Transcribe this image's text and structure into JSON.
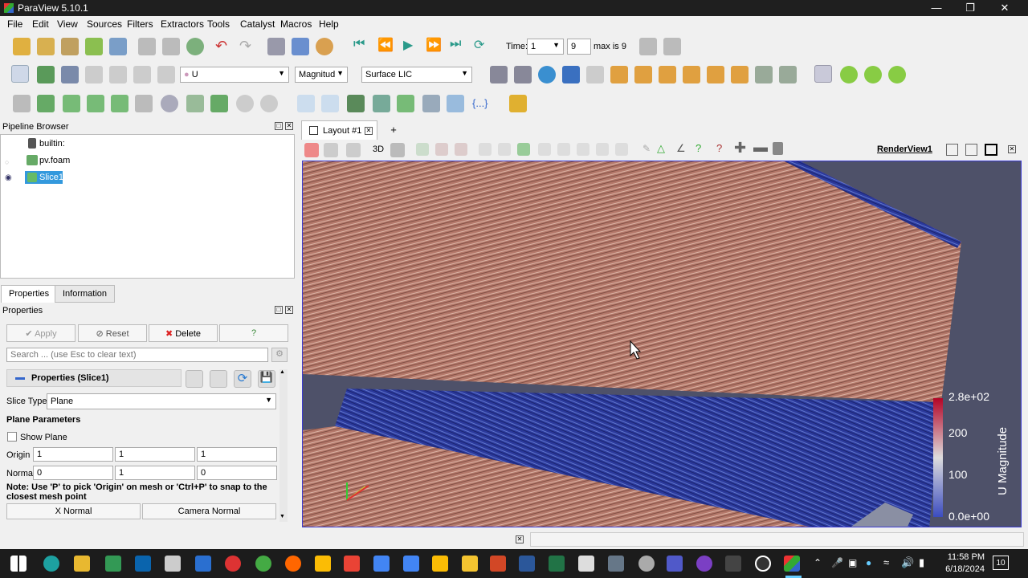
{
  "window": {
    "title": "ParaView 5.10.1"
  },
  "menu": [
    "File",
    "Edit",
    "View",
    "Sources",
    "Filters",
    "Extractors",
    "Tools",
    "Catalyst",
    "Macros",
    "Help"
  ],
  "time_toolbar": {
    "time_label": "Time:",
    "time_value": "1",
    "step_value": "9",
    "max_label": "max is 9"
  },
  "display_toolbar": {
    "array": "U",
    "component": "Magnitud",
    "representation": "Surface LIC"
  },
  "pipeline_browser": {
    "title": "Pipeline Browser",
    "items": [
      {
        "label": "builtin:"
      },
      {
        "label": "pv.foam"
      },
      {
        "label": "Slice1"
      }
    ]
  },
  "properties": {
    "tabs": [
      "Properties",
      "Information"
    ],
    "title": "Properties",
    "apply": "Apply",
    "reset": "Reset",
    "delete": "Delete",
    "help": "?",
    "search_placeholder": "Search ... (use Esc to clear text)",
    "section": "Properties (Slice1)",
    "slice_type_label": "Slice Type",
    "slice_type_value": "Plane",
    "plane_params": "Plane Parameters",
    "show_plane": "Show Plane",
    "origin_label": "Origin",
    "origin": [
      "1",
      "1",
      "1"
    ],
    "normal_label": "Normal",
    "normal": [
      "0",
      "1",
      "0"
    ],
    "note": "Note: Use 'P' to pick 'Origin' on mesh or 'Ctrl+P' to snap to the closest mesh point",
    "x_normal": "X Normal",
    "camera_normal": "Camera Normal"
  },
  "layout": {
    "tab": "Layout #1",
    "add": "+",
    "view_name": "RenderView1",
    "mode_3d": "3D"
  },
  "colorbar": {
    "title": "U Magnitude",
    "labels": [
      "2.8e+02",
      "200",
      "100",
      "0.0e+00"
    ]
  },
  "taskbar": {
    "time": "11:58 PM",
    "date": "6/18/2024",
    "badge": "10"
  },
  "colors": {
    "accent": "#3b3bd1",
    "lic_warm": "#b97a66",
    "lic_cool": "#2b3a9e"
  }
}
